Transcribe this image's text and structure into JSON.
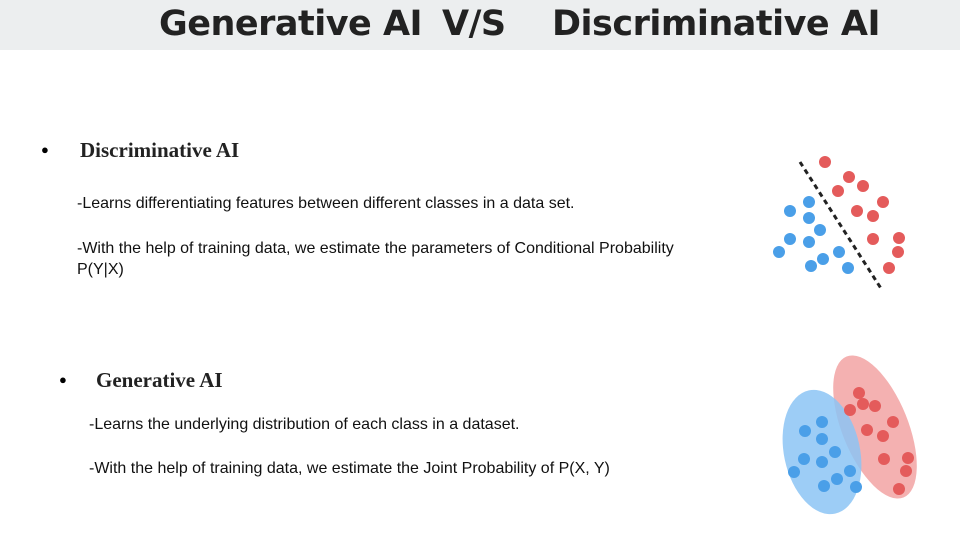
{
  "header": {
    "left": "Generative AI",
    "vs": "V/S",
    "right": "Discriminative AI"
  },
  "discriminative": {
    "bullet": "●",
    "heading": "Discriminative AI",
    "line1": "-Learns differentiating features between different classes in a data set.",
    "line2": "-With the help of training data, we estimate the parameters of  Conditional Probability P(Y|X)"
  },
  "generative": {
    "bullet": "●",
    "heading": "Generative AI",
    "line1": "-Learns the underlying distribution of each class in a dataset.",
    "line2": "-With the help of training data, we estimate the Joint Probability of P(X, Y)"
  },
  "colors": {
    "title_bar": "#eceeef",
    "blue_points": "#4a9fe8",
    "red_points": "#e45b5b",
    "blue_region": "#8cc4f5",
    "red_region": "#f2a3a3",
    "boundary": "#222222"
  }
}
